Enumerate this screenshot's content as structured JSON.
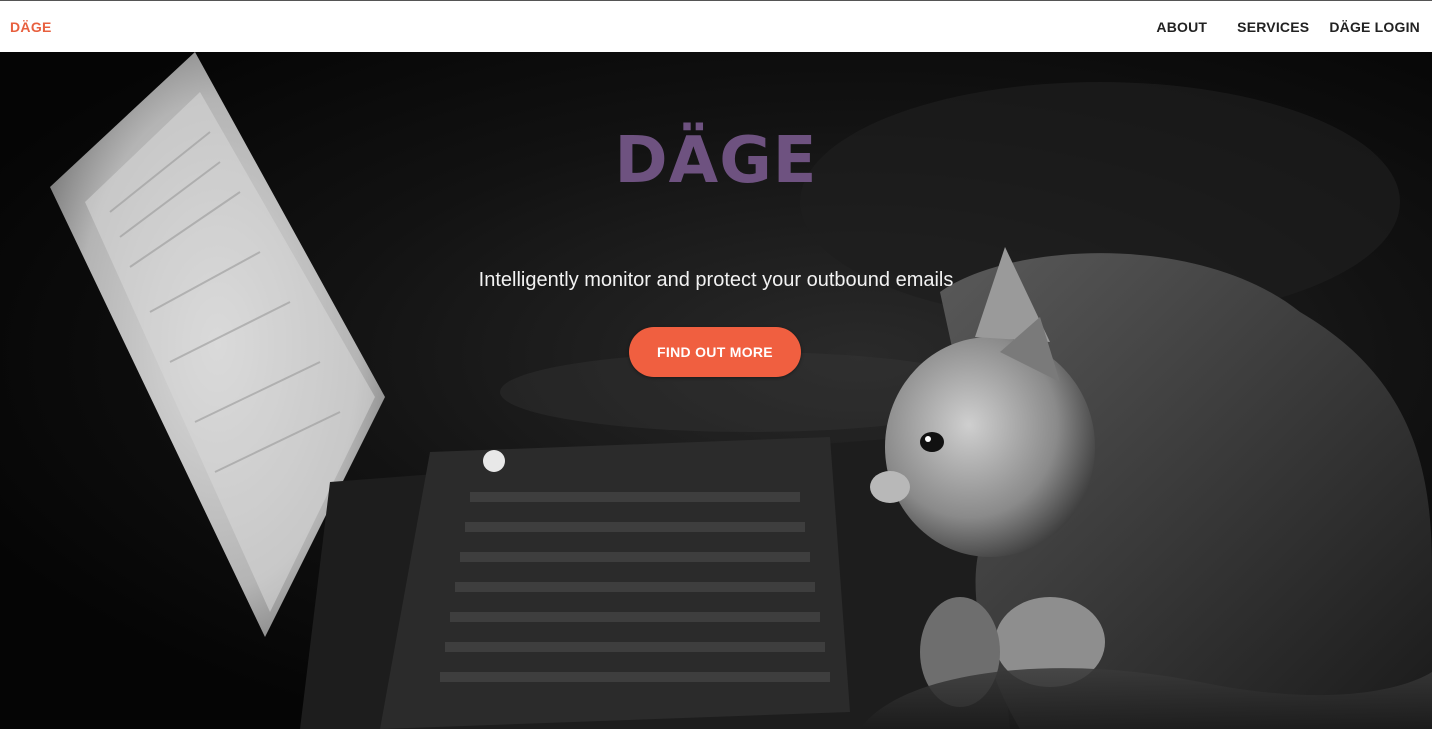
{
  "nav": {
    "brand": "DÄGE",
    "links": [
      {
        "label": "ABOUT"
      },
      {
        "label": "SERVICES"
      },
      {
        "label": "DÄGE LOGIN"
      }
    ]
  },
  "hero": {
    "title": "DÄGE",
    "tagline": "Intelligently monitor and protect your outbound emails",
    "cta_label": "FIND OUT MORE",
    "background_image": "black-and-white photo of a kitten looking at a laptop screen"
  },
  "colors": {
    "brand_accent": "#f05f40",
    "title_purple": "#6e5280",
    "nav_bg": "#ffffff",
    "hero_bg": "#111111"
  }
}
